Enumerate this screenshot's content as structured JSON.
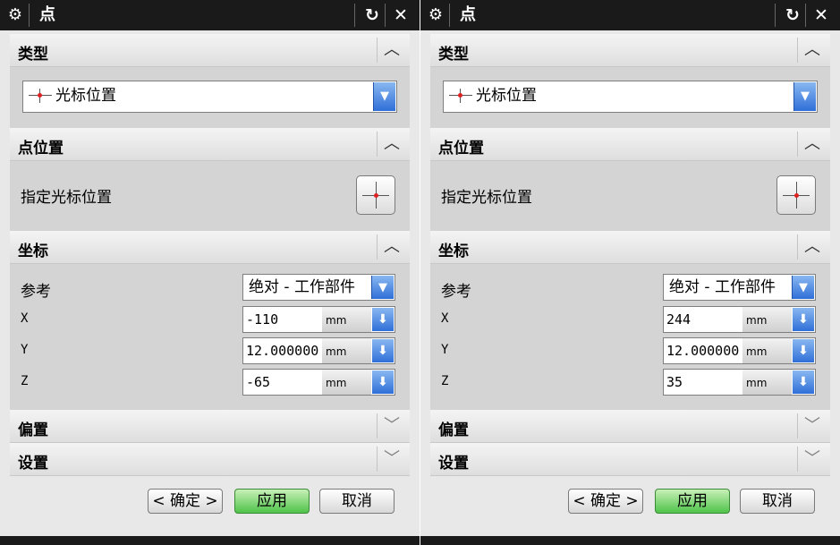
{
  "dialogs": [
    {
      "title": "点",
      "reset_icon": "reset-icon",
      "close_icon": "close-icon",
      "type_section": {
        "label": "类型",
        "combo_value": "光标位置"
      },
      "point_location": {
        "label": "点位置",
        "specify_label": "指定光标位置"
      },
      "coordinates": {
        "label": "坐标",
        "reference_label": "参考",
        "reference_value": "绝对 - 工作部件",
        "x_label": "X",
        "x_value": "-110",
        "x_unit": "mm",
        "y_label": "Y",
        "y_value": "12.000000",
        "y_unit": "mm",
        "z_label": "Z",
        "z_value": "-65",
        "z_unit": "mm"
      },
      "offset_section": {
        "label": "偏置"
      },
      "settings_section": {
        "label": "设置"
      },
      "buttons": {
        "ok": "< 确定 >",
        "apply": "应用",
        "cancel": "取消"
      }
    },
    {
      "title": "点",
      "reset_icon": "reset-icon",
      "close_icon": "close-icon",
      "type_section": {
        "label": "类型",
        "combo_value": "光标位置"
      },
      "point_location": {
        "label": "点位置",
        "specify_label": "指定光标位置"
      },
      "coordinates": {
        "label": "坐标",
        "reference_label": "参考",
        "reference_value": "绝对 - 工作部件",
        "x_label": "X",
        "x_value": "244",
        "x_unit": "mm",
        "y_label": "Y",
        "y_value": "12.000000",
        "y_unit": "mm",
        "z_label": "Z",
        "z_value": "35",
        "z_unit": "mm"
      },
      "offset_section": {
        "label": "偏置"
      },
      "settings_section": {
        "label": "设置"
      },
      "buttons": {
        "ok": "< 确定 >",
        "apply": "应用",
        "cancel": "取消"
      }
    }
  ],
  "colors": {
    "titlebar": "#1a1a1a",
    "dialog_bg": "#d4d4d4",
    "accent_blue": "#2f6fd8",
    "apply_green": "#4fc34a",
    "point_marker": "#e02020"
  }
}
